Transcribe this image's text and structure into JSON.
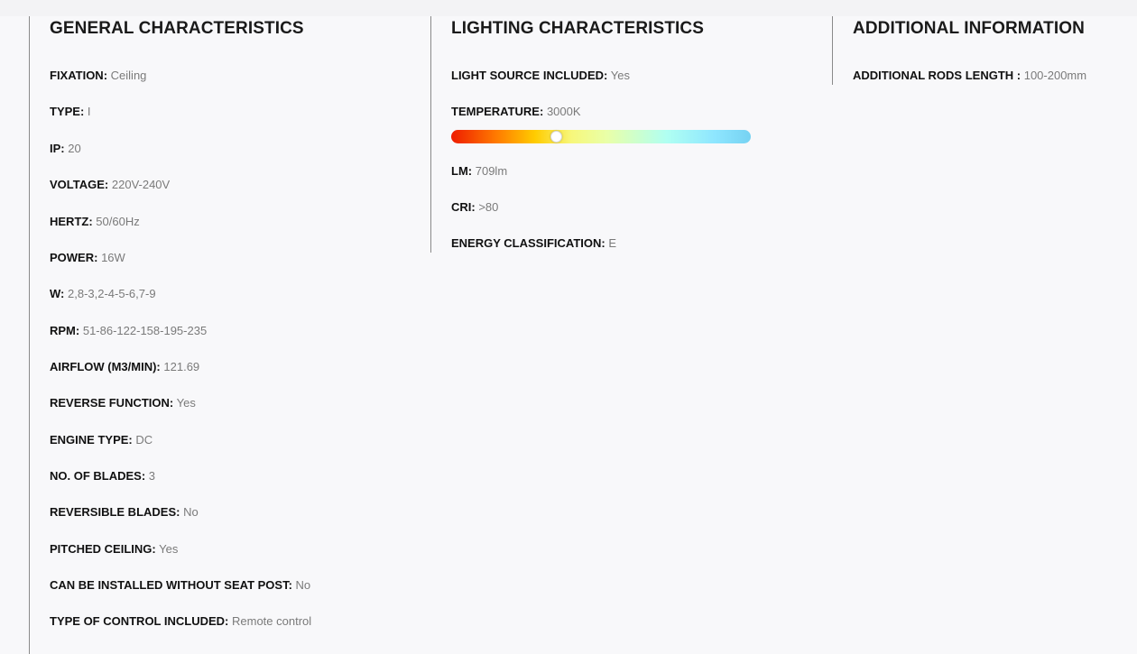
{
  "general": {
    "title": "GENERAL CHARACTERISTICS",
    "rows": [
      {
        "label": "FIXATION:",
        "value": "Ceiling"
      },
      {
        "label": "TYPE:",
        "value": "I"
      },
      {
        "label": "IP:",
        "value": "20"
      },
      {
        "label": "VOLTAGE:",
        "value": "220V-240V"
      },
      {
        "label": "HERTZ:",
        "value": "50/60Hz"
      },
      {
        "label": "POWER:",
        "value": "16W"
      },
      {
        "label": "W:",
        "value": "2,8-3,2-4-5-6,7-9"
      },
      {
        "label": "RPM:",
        "value": "51-86-122-158-195-235"
      },
      {
        "label": "AIRFLOW (M3/MIN):",
        "value": "121.69"
      },
      {
        "label": "REVERSE FUNCTION:",
        "value": "Yes"
      },
      {
        "label": "ENGINE TYPE:",
        "value": "DC"
      },
      {
        "label": "NO. OF BLADES:",
        "value": "3"
      },
      {
        "label": "REVERSIBLE BLADES:",
        "value": "No"
      },
      {
        "label": "PITCHED CEILING:",
        "value": "Yes"
      },
      {
        "label": "CAN BE INSTALLED WITHOUT SEAT POST:",
        "value": "No"
      },
      {
        "label": "TYPE OF CONTROL INCLUDED:",
        "value": "Remote control"
      }
    ]
  },
  "lighting": {
    "title": "LIGHTING CHARACTERISTICS",
    "light_source": {
      "label": "LIGHT SOURCE INCLUDED:",
      "value": "Yes"
    },
    "temperature": {
      "label": "TEMPERATURE:",
      "value": "3000K",
      "scale_position": 0.35
    },
    "rows": [
      {
        "label": "LM:",
        "value": "709lm"
      },
      {
        "label": "CRI:",
        "value": ">80"
      },
      {
        "label": "ENERGY CLASSIFICATION:",
        "value": "E"
      }
    ]
  },
  "additional": {
    "title": "ADDITIONAL INFORMATION",
    "rows": [
      {
        "label": "ADDITIONAL RODS LENGTH :",
        "value": "100-200mm"
      }
    ]
  }
}
